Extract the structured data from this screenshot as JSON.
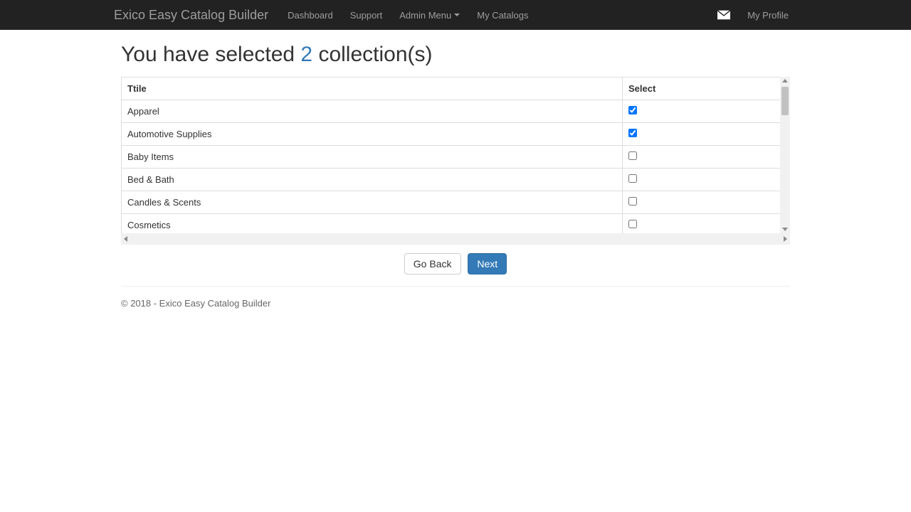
{
  "navbar": {
    "brand": "Exico Easy Catalog Builder",
    "links": {
      "dashboard": "Dashboard",
      "support": "Support",
      "admin_menu": "Admin Menu",
      "my_catalogs": "My Catalogs",
      "my_profile": "My Profile"
    }
  },
  "heading": {
    "prefix": "You have selected ",
    "count": "2",
    "suffix": " collection(s)"
  },
  "table": {
    "headers": {
      "title": "Ttile",
      "select": "Select"
    },
    "rows": [
      {
        "title": "Apparel",
        "selected": true
      },
      {
        "title": "Automotive Supplies",
        "selected": true
      },
      {
        "title": "Baby Items",
        "selected": false
      },
      {
        "title": "Bed & Bath",
        "selected": false
      },
      {
        "title": "Candles & Scents",
        "selected": false
      },
      {
        "title": "Cosmetics",
        "selected": false
      }
    ]
  },
  "buttons": {
    "back": "Go Back",
    "next": "Next"
  },
  "footer": "© 2018 - Exico Easy Catalog Builder"
}
